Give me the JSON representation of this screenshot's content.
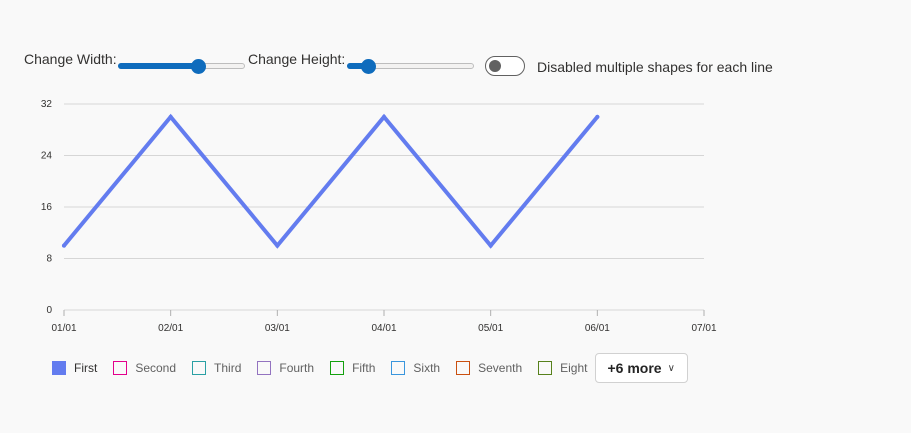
{
  "controls": {
    "width_label": "Change Width:",
    "width_value": 0.62,
    "height_label": "Change Height:",
    "height_value": 0.16,
    "toggle_label": "Disabled multiple shapes for each line",
    "toggle_on": false
  },
  "chart_data": {
    "type": "line",
    "title": "",
    "xlabel": "",
    "ylabel": "",
    "x": [
      "01/01",
      "02/01",
      "03/01",
      "04/01",
      "05/01",
      "06/01"
    ],
    "x_ticks": [
      "01/01",
      "02/01",
      "03/01",
      "04/01",
      "05/01",
      "06/01",
      "07/01"
    ],
    "y_ticks": [
      "0",
      "8",
      "16",
      "24",
      "32"
    ],
    "ylim": [
      0,
      32
    ],
    "grid": true,
    "series": [
      {
        "name": "First",
        "values": [
          10,
          30,
          10,
          30,
          10,
          30
        ],
        "color": "#637cef"
      }
    ]
  },
  "legend": {
    "items": [
      {
        "name": "First",
        "color": "#637cef",
        "active": true
      },
      {
        "name": "Second",
        "color": "#e3008c",
        "active": false
      },
      {
        "name": "Third",
        "color": "#2aa0a4",
        "active": false
      },
      {
        "name": "Fourth",
        "color": "#9373c0",
        "active": false
      },
      {
        "name": "Fifth",
        "color": "#13a10e",
        "active": false
      },
      {
        "name": "Sixth",
        "color": "#3a96dd",
        "active": false
      },
      {
        "name": "Seventh",
        "color": "#ca5010",
        "active": false
      },
      {
        "name": "Eight",
        "color": "#57811b",
        "active": false
      }
    ],
    "more_label": "+6 more"
  }
}
